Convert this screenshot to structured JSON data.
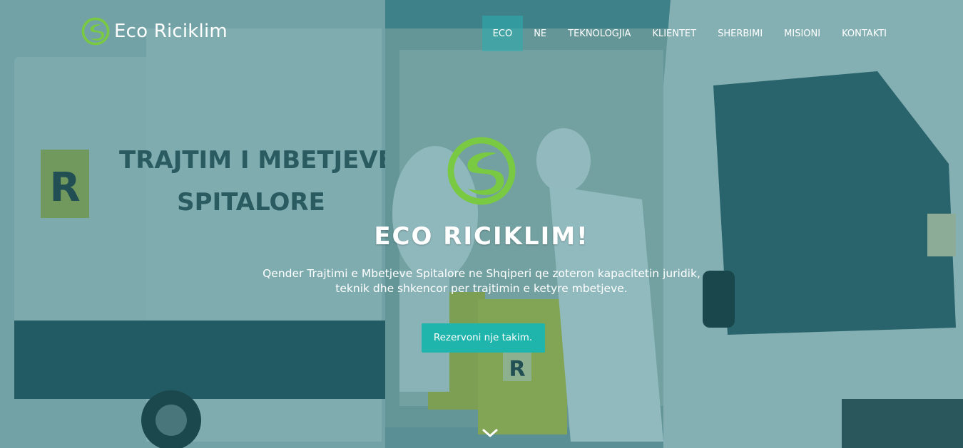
{
  "brand": {
    "name": "Eco Riciklim",
    "logo_icon": "eco-leaf-logo-icon",
    "logo_color": "#7ac943"
  },
  "nav": {
    "items": [
      {
        "label": "ECO",
        "active": true
      },
      {
        "label": "NE",
        "active": false
      },
      {
        "label": "TEKNOLOGJIA",
        "active": false
      },
      {
        "label": "KLIENTET",
        "active": false
      },
      {
        "label": "SHERBIMI",
        "active": false
      },
      {
        "label": "MISIONI",
        "active": false
      },
      {
        "label": "KONTAKTI",
        "active": false
      }
    ]
  },
  "hero": {
    "title": "ECO RICIKLIM!",
    "subtitle": "Qender Trajtimi e Mbetjeve Spitalore ne Shqiperi qe zoteron kapacitetin juridik, teknik dhe shkencor per trajtimin e ketyre mbetjeve.",
    "cta_label": "Rezervoni nje takim.",
    "scroll_icon": "chevron-down-icon",
    "background_image": "hospital-waste-van-photo",
    "van_text_line1": "TRAJTIM I MBETJEVE",
    "van_text_line2": "SPITALORE",
    "van_sign_letter": "R",
    "bin_letter": "R"
  },
  "colors": {
    "accent": "#1fb5ad",
    "overlay": "#146e78",
    "logo_green": "#7ac943"
  }
}
